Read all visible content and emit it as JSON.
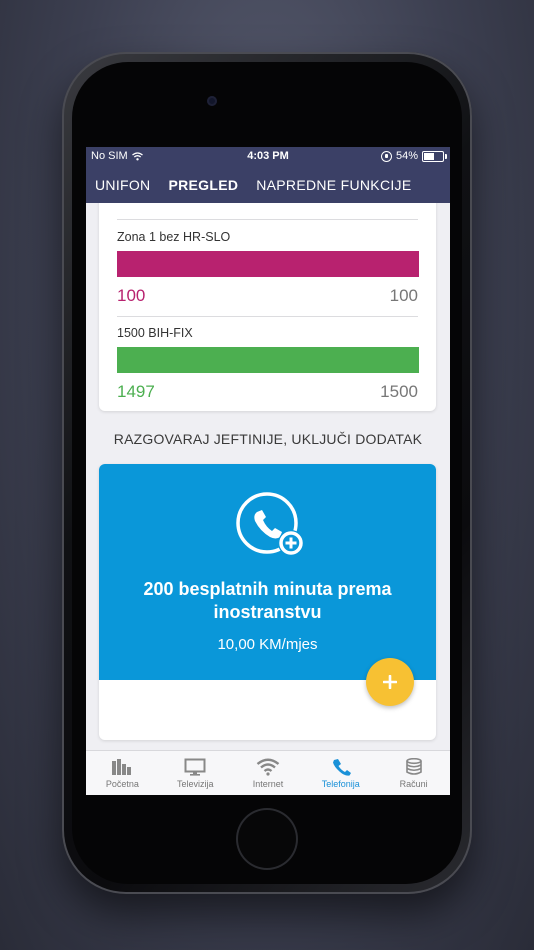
{
  "status_bar": {
    "carrier": "No SIM",
    "time": "4:03 PM",
    "battery": "54%",
    "battery_level": 0.54,
    "icons": [
      "wifi-icon",
      "orientation-lock-icon",
      "battery-icon"
    ]
  },
  "navbar": {
    "tabs": [
      {
        "label": "UNIFON",
        "active": false
      },
      {
        "label": "PREGLED",
        "active": true
      },
      {
        "label": "NAPREDNE FUNKCIJE",
        "active": false
      }
    ]
  },
  "usage": {
    "items": [
      {
        "name": "Zona 1 bez HR-SLO",
        "remaining": "100",
        "total": "100",
        "fraction": 1.0,
        "color": "#b8226f"
      },
      {
        "name": "1500 BIH-FIX",
        "remaining": "1497",
        "total": "1500",
        "fraction": 1.0,
        "color": "#4caf50"
      }
    ]
  },
  "promo": {
    "heading": "RAZGOVARAJ JEFTINIJE, UKLJUČI DODATAK",
    "icon": "phone-plus-icon",
    "title_line1": "200 besplatnih minuta prema",
    "title_line2": "inostranstvu",
    "price": "10,00 KM/mjes",
    "add_button_icon": "plus-icon",
    "card_color": "#0a97d9",
    "button_color": "#f7c133"
  },
  "tabbar": {
    "items": [
      {
        "label": "Početna",
        "icon": "bar-chart-icon",
        "active": false
      },
      {
        "label": "Televizija",
        "icon": "tv-icon",
        "active": false
      },
      {
        "label": "Internet",
        "icon": "wifi-icon",
        "active": false
      },
      {
        "label": "Telefonija",
        "icon": "phone-icon",
        "active": true
      },
      {
        "label": "Računi",
        "icon": "coins-icon",
        "active": false
      }
    ]
  },
  "colors": {
    "header": "#3b4066",
    "accent": "#1a91d8"
  }
}
